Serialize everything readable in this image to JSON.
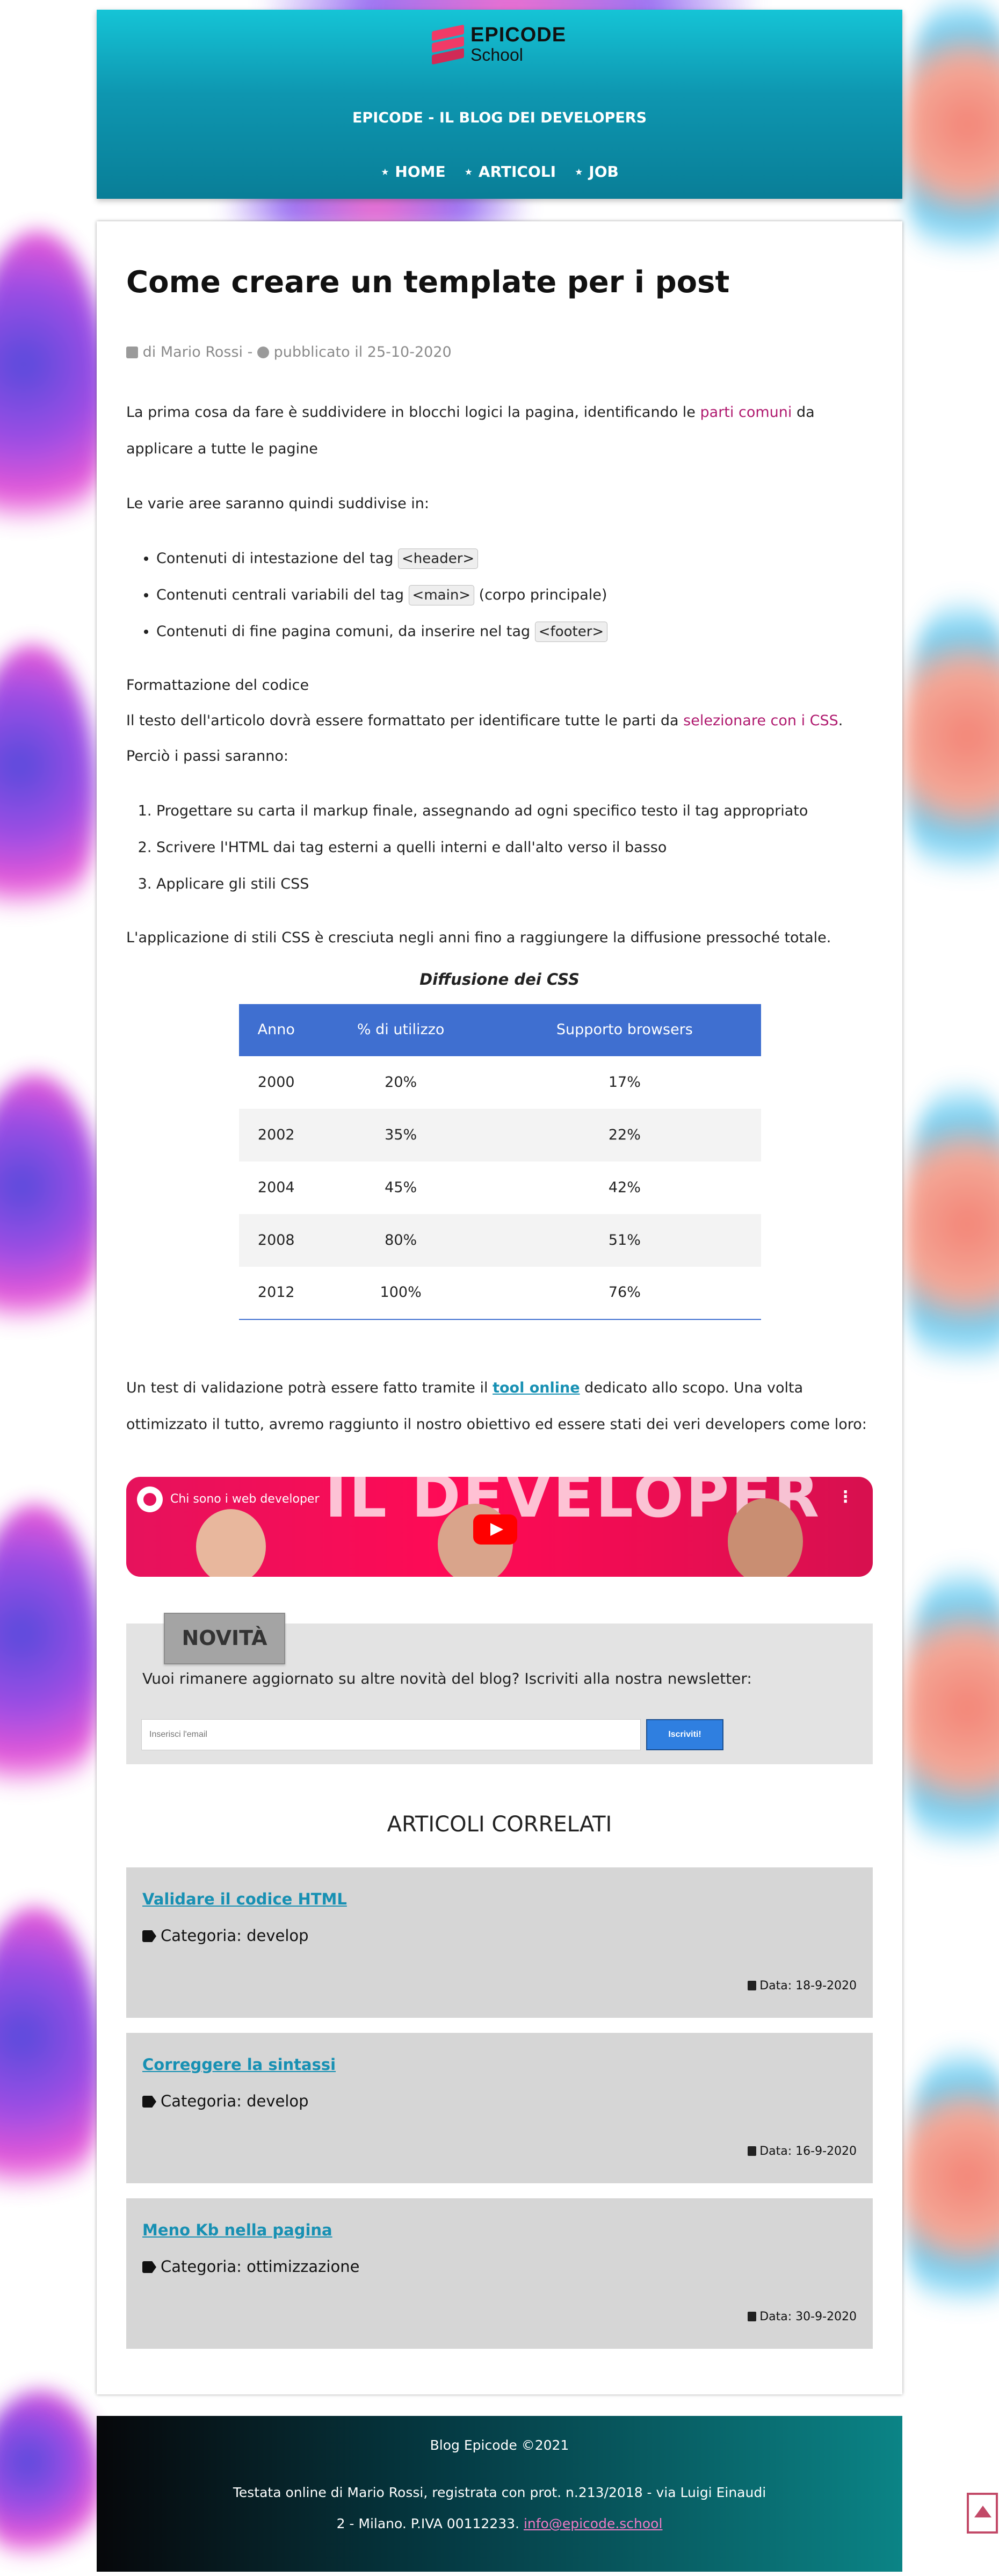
{
  "header": {
    "logo_line1": "EPICODE",
    "logo_line2": "School",
    "tagline": "EPICODE - IL BLOG DEI DEVELOPERS",
    "nav": [
      "⋆ HOME",
      "⋆ ARTICOLI",
      "⋆ JOB"
    ]
  },
  "article": {
    "title": "Come creare un template per i post",
    "author": "di Mario Rossi - ",
    "published": "pubblicato il 25-10-2020",
    "p1_before": "La prima cosa da fare è suddividere in blocchi logici la pagina, identificando le ",
    "p1_accent": "parti comuni",
    "p1_after": " da applicare a tutte le pagine",
    "p2": "Le varie aree saranno quindi suddivise in:",
    "list": [
      {
        "before": "Contenuti di intestazione del tag ",
        "code": "<header>",
        "after": ""
      },
      {
        "before": "Contenuti centrali variabili del tag ",
        "code": "<main>",
        "after": " (corpo principale)"
      },
      {
        "before": "Contenuti di fine pagina comuni, da inserire nel tag ",
        "code": "<footer>",
        "after": ""
      }
    ],
    "h_format": "Formattazione del codice",
    "p3_before": "Il testo dell'articolo dovrà essere formattato per identificare tutte le parti da ",
    "p3_accent": "selezionare con i CSS",
    "p3_after": ".",
    "p4": "Perciò i passi saranno:",
    "steps": [
      "Progettare su carta il markup finale, assegnando ad ogni specifico testo il tag appropriato",
      "Scrivere l'HTML dai tag esterni a quelli interni e dall'alto verso il basso",
      "Applicare gli stili CSS"
    ],
    "p5": "L'applicazione di stili CSS è cresciuta negli anni fino a raggiungere la diffusione pressoché totale.",
    "p6_before": "Un test di validazione potrà essere fatto tramite il ",
    "p6_link": "tool online",
    "p6_after": " dedicato allo scopo. Una volta ottimizzato il tutto, avremo raggiunto il nostro obiettivo ed essere stati dei veri developers come loro:"
  },
  "table": {
    "caption": "Diffusione dei CSS",
    "headers": [
      "Anno",
      "% di utilizzo",
      "Supporto browsers"
    ],
    "rows": [
      [
        "2000",
        "20%",
        "17%"
      ],
      [
        "2002",
        "35%",
        "22%"
      ],
      [
        "2004",
        "45%",
        "42%"
      ],
      [
        "2008",
        "80%",
        "51%"
      ],
      [
        "2012",
        "100%",
        "76%"
      ]
    ]
  },
  "video": {
    "channel_title": "Chi sono i web developer",
    "overlay_text": "IL DEVELOPER"
  },
  "newsletter": {
    "badge": "NOVITÀ",
    "text": "Vuoi rimanere aggiornato su altre novità del blog? Iscriviti alla nostra newsletter:",
    "placeholder": "Inserisci l'email",
    "button": "Iscriviti!"
  },
  "related": {
    "title": "ARTICOLI CORRELATI",
    "items": [
      {
        "title": "Validare il codice HTML",
        "category": "Categoria: develop",
        "date": "Data: 18-9-2020"
      },
      {
        "title": "Correggere la sintassi",
        "category": "Categoria: develop",
        "date": "Data: 16-9-2020"
      },
      {
        "title": "Meno Kb nella pagina",
        "category": "Categoria: ottimizzazione",
        "date": "Data: 30-9-2020"
      }
    ]
  },
  "footer": {
    "line1": "Blog Epicode ©2021",
    "line2": "Testata online di Mario Rossi, registrata con prot. n.213/2018 - via Luigi Einaudi",
    "line3": "2 - Milano. P.IVA 00112233. ",
    "email": "info@epicode.school"
  },
  "icons": {
    "author": "pencil-square-icon",
    "published": "clock-icon",
    "category": "tag-icon",
    "date": "calendar-icon",
    "back_to_top": "arrow-up-icon"
  },
  "colors": {
    "header_top": "#15c4d6",
    "header_bottom": "#097e97",
    "accent": "#b01a6f",
    "table_header": "#3f6fd0",
    "link": "#1790b3",
    "subscribe_button": "#2f7fe0"
  }
}
